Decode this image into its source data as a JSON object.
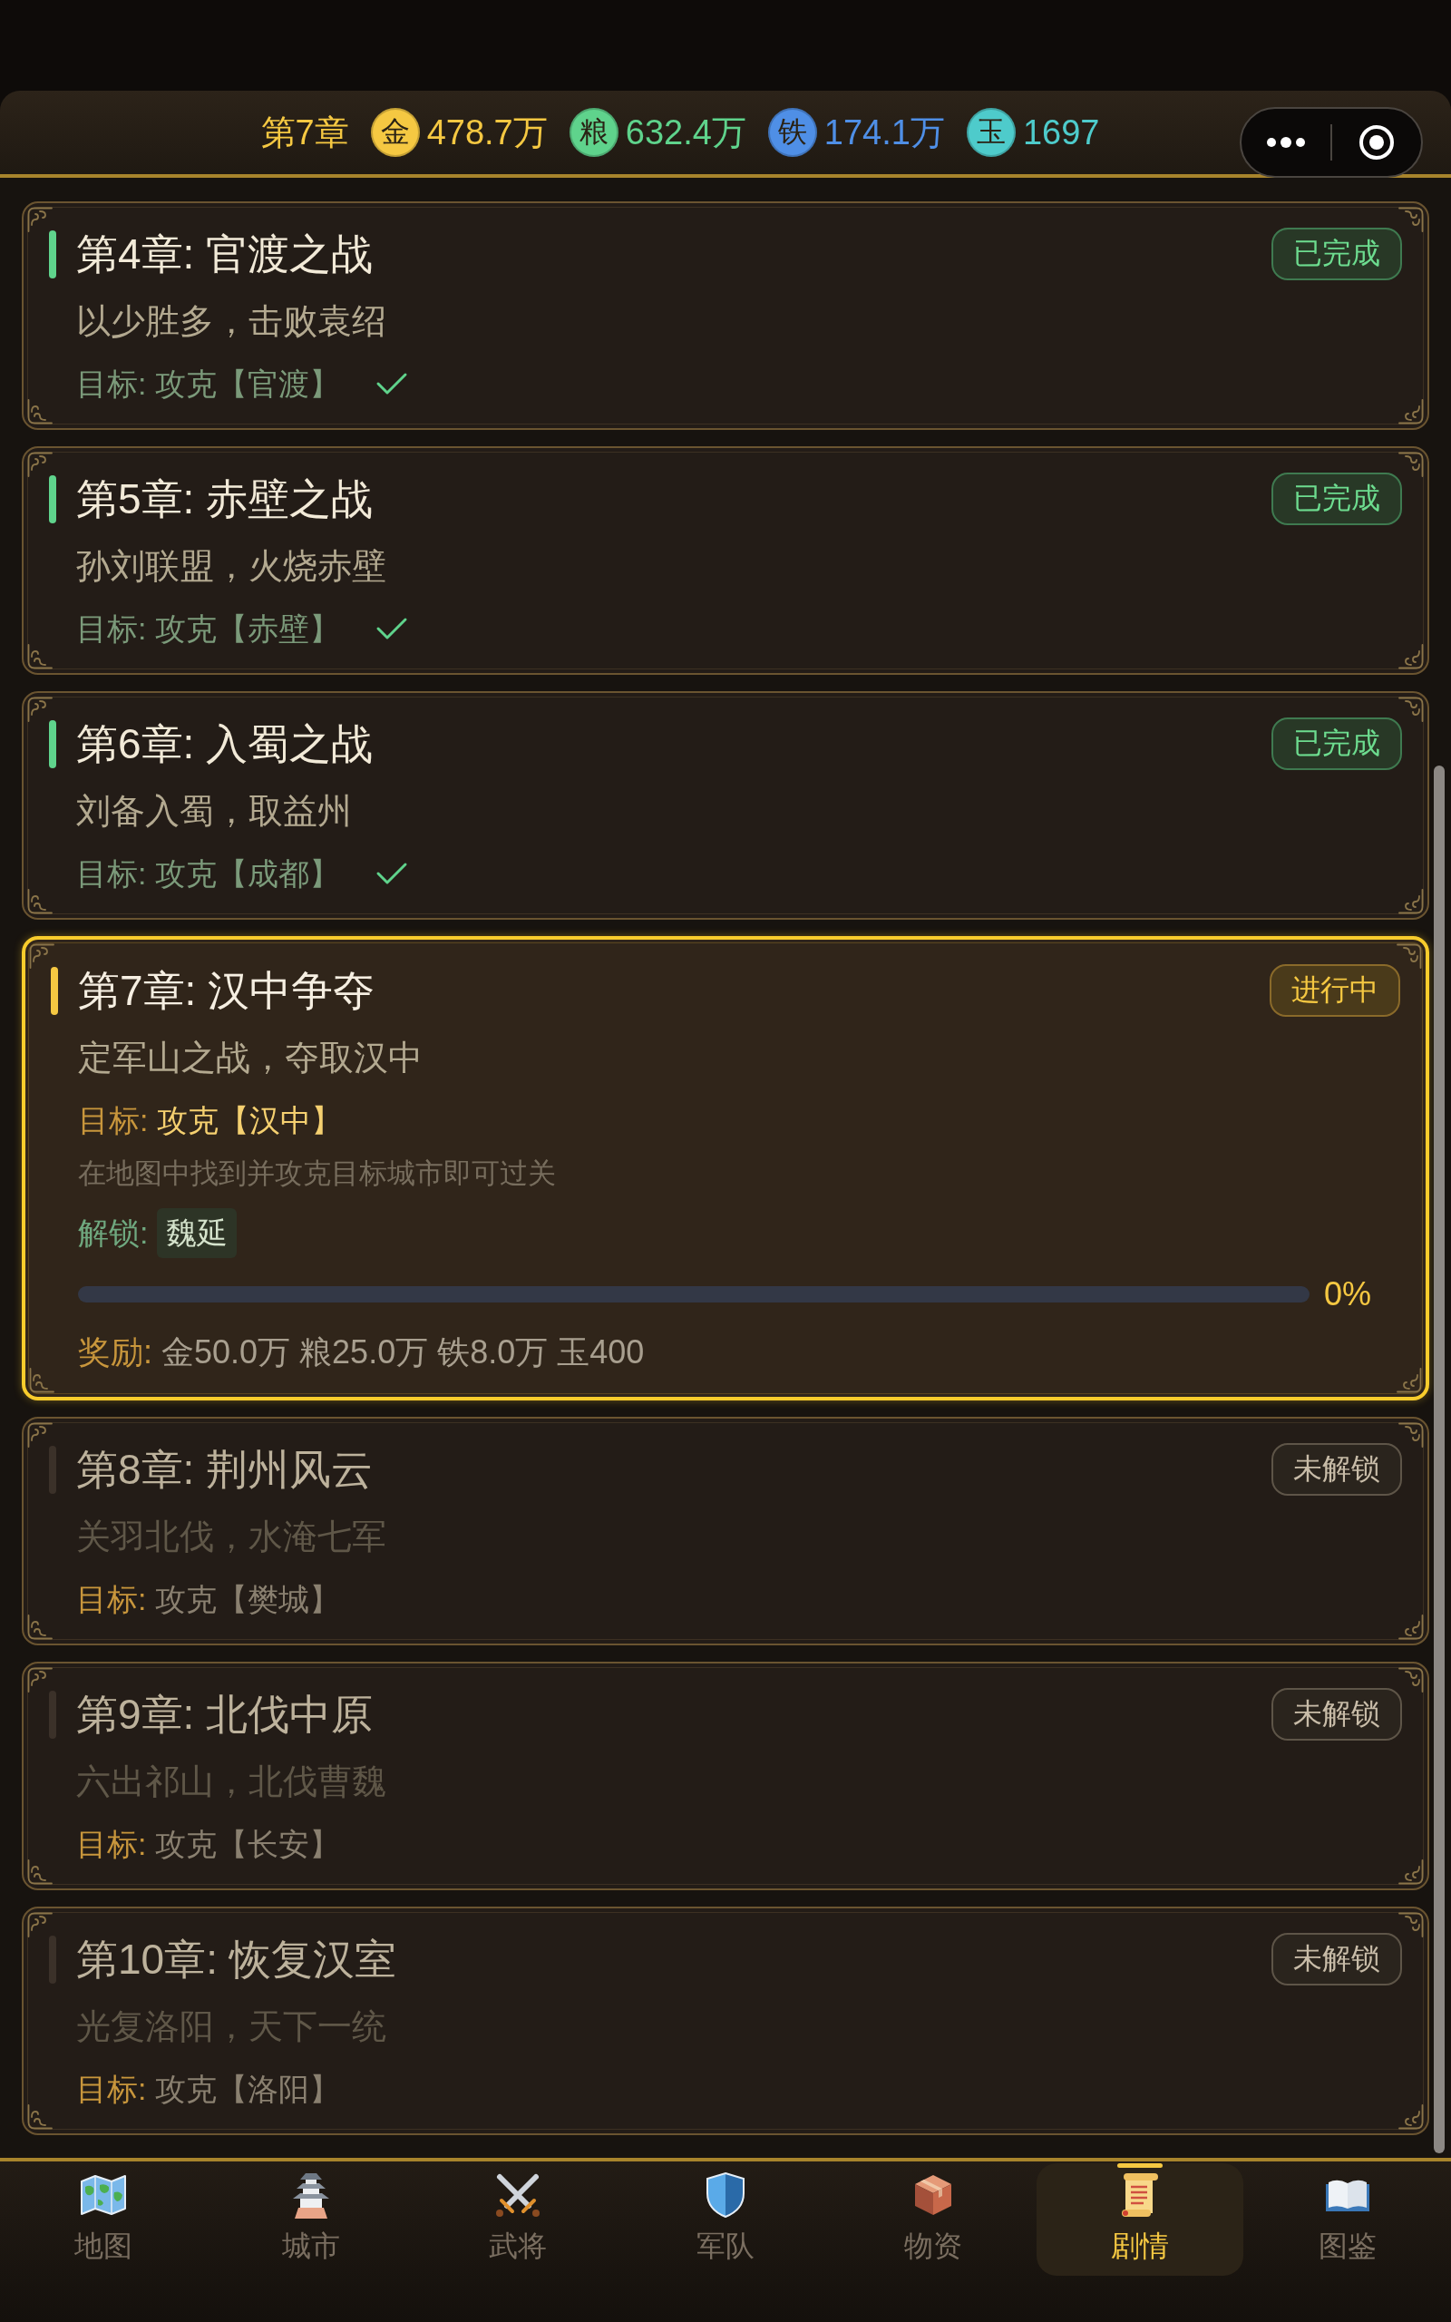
{
  "header": {
    "chapter": "第7章",
    "resources": [
      {
        "symbol": "金",
        "value": "478.7万",
        "color": "#f5c842"
      },
      {
        "symbol": "粮",
        "value": "632.4万",
        "color": "#5fd38c"
      },
      {
        "symbol": "铁",
        "value": "174.1万",
        "color": "#4f8fe6"
      },
      {
        "symbol": "玉",
        "value": "1697",
        "color": "#4ecbcb"
      }
    ]
  },
  "chapters": [
    {
      "kind": "completed",
      "title": "第4章: 官渡之战",
      "badge": "已完成",
      "description": "以少胜多，击败袁绍",
      "target_label": "目标:",
      "target": "攻克【官渡】"
    },
    {
      "kind": "completed",
      "title": "第5章: 赤壁之战",
      "badge": "已完成",
      "description": "孙刘联盟，火烧赤壁",
      "target_label": "目标:",
      "target": "攻克【赤壁】"
    },
    {
      "kind": "completed",
      "title": "第6章: 入蜀之战",
      "badge": "已完成",
      "description": "刘备入蜀，取益州",
      "target_label": "目标:",
      "target": "攻克【成都】"
    },
    {
      "kind": "active",
      "title": "第7章: 汉中争夺",
      "badge": "进行中",
      "description": "定军山之战，夺取汉中",
      "target_label": "目标:",
      "target": "攻克【汉中】",
      "hint": "在地图中找到并攻克目标城市即可过关",
      "unlock_label": "解锁:",
      "unlocks": [
        "魏延"
      ],
      "progress": {
        "level": 0,
        "reading": "0%"
      },
      "reward_label": "奖励:",
      "rewards": "金50.0万 粮25.0万 铁8.0万 玉400"
    },
    {
      "kind": "locked",
      "title": "第8章: 荆州风云",
      "badge": "未解锁",
      "description": "关羽北伐，水淹七军",
      "target_label": "目标:",
      "target": "攻克【樊城】"
    },
    {
      "kind": "locked",
      "title": "第9章: 北伐中原",
      "badge": "未解锁",
      "description": "六出祁山，北伐曹魏",
      "target_label": "目标:",
      "target": "攻克【长安】"
    },
    {
      "kind": "locked",
      "title": "第10章: 恢复汉室",
      "badge": "未解锁",
      "description": "光复洛阳，天下一统",
      "target_label": "目标:",
      "target": "攻克【洛阳】"
    }
  ],
  "nav": [
    {
      "label": "地图",
      "selected": false
    },
    {
      "label": "城市",
      "selected": false
    },
    {
      "label": "武将",
      "selected": false
    },
    {
      "label": "军队",
      "selected": false
    },
    {
      "label": "物资",
      "selected": false
    },
    {
      "label": "剧情",
      "selected": true
    },
    {
      "label": "图鉴",
      "selected": false
    }
  ]
}
